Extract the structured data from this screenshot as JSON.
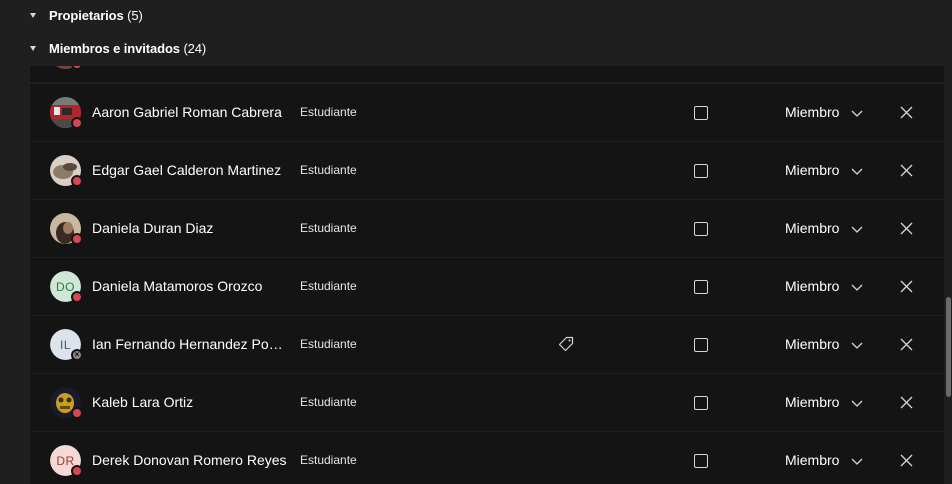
{
  "sections": {
    "owners": {
      "label": "Propietarios",
      "count": "(5)"
    },
    "members": {
      "label": "Miembros e invitados",
      "count": "(24)"
    }
  },
  "members": [
    {
      "name": "Aaron Gabriel Roman Cabrera",
      "role": "Estudiante",
      "member_role": "Miembro",
      "avatar": "photo",
      "status": "busy"
    },
    {
      "name": "Edgar Gael Calderon Martinez",
      "role": "Estudiante",
      "member_role": "Miembro",
      "avatar": "photo",
      "status": "busy"
    },
    {
      "name": "Daniela Duran Diaz",
      "role": "Estudiante",
      "member_role": "Miembro",
      "avatar": "photo",
      "status": "busy"
    },
    {
      "name": "Daniela Matamoros Orozco",
      "role": "Estudiante",
      "member_role": "Miembro",
      "avatar": "DO",
      "status": "busy"
    },
    {
      "name": "Ian Fernando Hernandez Ponce",
      "role": "Estudiante",
      "member_role": "Miembro",
      "avatar": "IL",
      "status": "offline",
      "has_tag": true
    },
    {
      "name": "Kaleb Lara Ortiz",
      "role": "Estudiante",
      "member_role": "Miembro",
      "avatar": "photo",
      "status": "busy"
    },
    {
      "name": "Derek Donovan Romero Reyes",
      "role": "Estudiante",
      "member_role": "Miembro",
      "avatar": "DR",
      "status": "busy"
    }
  ],
  "icons": {
    "caret": "caret-down-icon",
    "tag": "tag-icon",
    "chevron": "chevron-down-icon",
    "remove": "close-icon"
  },
  "colors": {
    "background": "#1f1f1f",
    "row_background": "#141414",
    "status_busy": "#d74654",
    "status_offline": "#8a8886"
  }
}
